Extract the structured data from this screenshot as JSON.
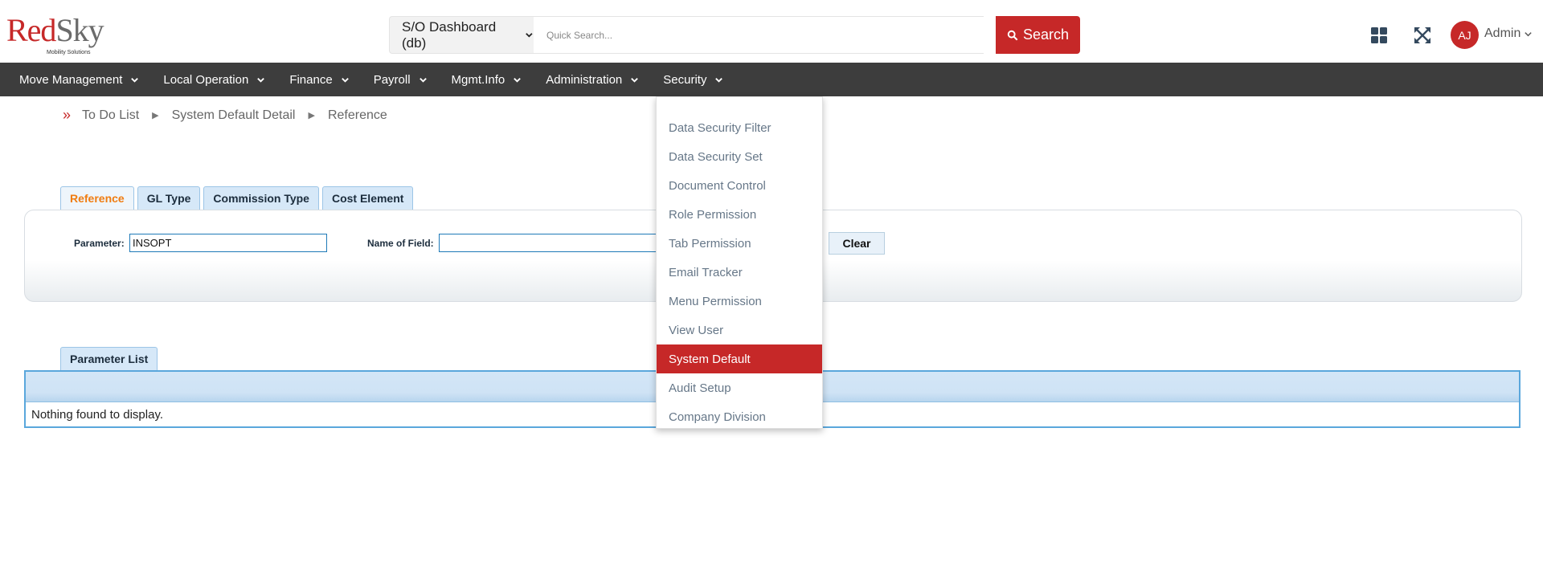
{
  "header": {
    "logo_main_red": "Red",
    "logo_main_grey": "Sky",
    "logo_sub": "Mobility Solutions",
    "dashboard_select": "S/O Dashboard (db)",
    "search_placeholder": "Quick Search...",
    "search_button": "Search",
    "avatar_initials": "AJ",
    "user_name": "Admin"
  },
  "nav": {
    "items": [
      {
        "label": "Move Management"
      },
      {
        "label": "Local Operation"
      },
      {
        "label": "Finance"
      },
      {
        "label": "Payroll"
      },
      {
        "label": "Mgmt.Info"
      },
      {
        "label": "Administration"
      },
      {
        "label": "Security"
      }
    ]
  },
  "breadcrumb": {
    "items": [
      "To Do List",
      "System Default Detail",
      "Reference"
    ]
  },
  "tabs": {
    "items": [
      {
        "label": "Reference",
        "active": true
      },
      {
        "label": "GL Type",
        "active": false
      },
      {
        "label": "Commission Type",
        "active": false
      },
      {
        "label": "Cost Element",
        "active": false
      }
    ]
  },
  "filter": {
    "parameter_label": "Parameter:",
    "parameter_value": "INSOPT",
    "name_of_field_label": "Name of Field:",
    "name_of_field_value": "",
    "clear_button": "Clear"
  },
  "parameter_list": {
    "tab_label": "Parameter List",
    "empty_message": "Nothing found to display."
  },
  "security_menu": {
    "items": [
      {
        "label": "Data Security Filter",
        "selected": false
      },
      {
        "label": "Data Security Set",
        "selected": false
      },
      {
        "label": "Document Control",
        "selected": false
      },
      {
        "label": "Role Permission",
        "selected": false
      },
      {
        "label": "Tab Permission",
        "selected": false
      },
      {
        "label": "Email Tracker",
        "selected": false
      },
      {
        "label": "Menu Permission",
        "selected": false
      },
      {
        "label": "View User",
        "selected": false
      },
      {
        "label": "System Default",
        "selected": true
      },
      {
        "label": "Audit Setup",
        "selected": false
      },
      {
        "label": "Company Division",
        "selected": false
      }
    ]
  },
  "colors": {
    "brand_red": "#c62828",
    "nav_bg": "#3d3d3d",
    "active_tab_text": "#f07c10"
  },
  "icons": {
    "dashboard": "grid-icon",
    "fullscreen": "expand-icon",
    "search": "search-icon",
    "chevron": "chevron-down-icon",
    "breadcrumb_start": "double-chevron-right-icon",
    "breadcrumb_sep": "triangle-right-icon"
  }
}
